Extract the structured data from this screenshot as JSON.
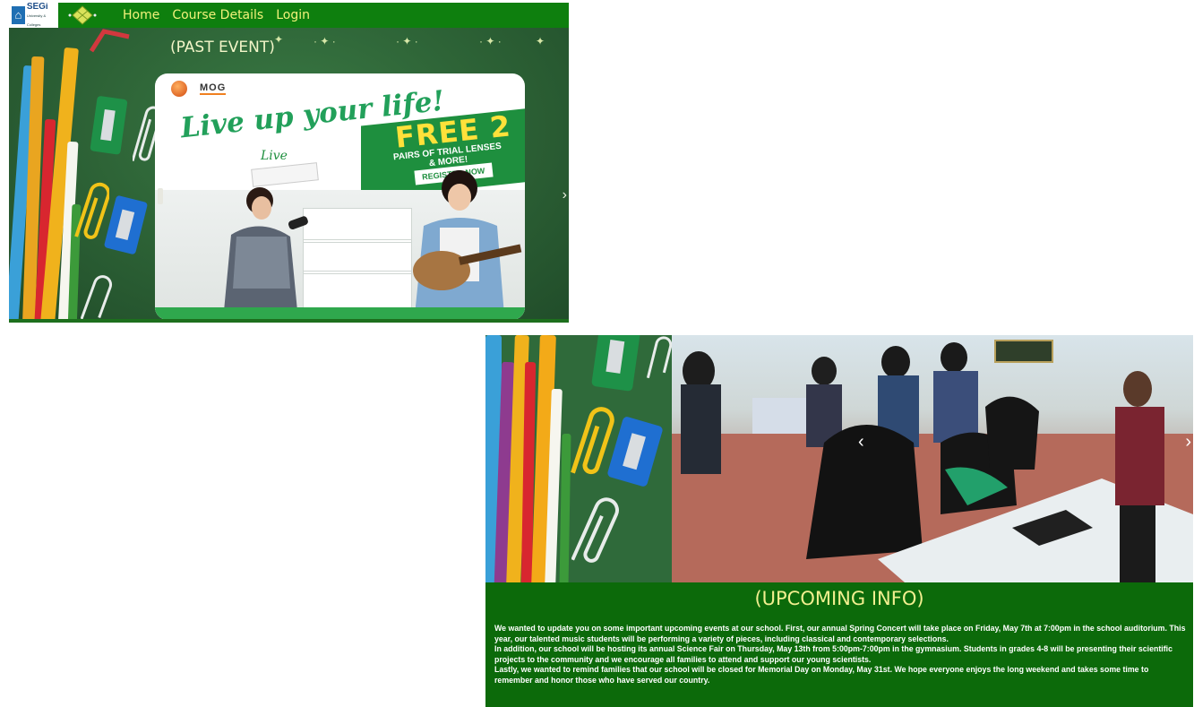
{
  "nav": {
    "logo_text": "SEGi",
    "logo_sub": "University & Colleges",
    "links": [
      "Home",
      "Course Details",
      "Login"
    ]
  },
  "past_event": {
    "title": "(PAST EVENT)",
    "ad": {
      "brand": "MOG",
      "headline": "Live up your life!",
      "free": "FREE 2",
      "trial": "PAIRS OF TRIAL LENSES & MORE!",
      "register": "REGISTER NOW",
      "product": "Live"
    }
  },
  "upcoming": {
    "title": "(UPCOMING INFO)",
    "paragraphs": [
      "We wanted to update you on some important upcoming events at our school. First, our annual Spring Concert will take place on Friday, May 7th at 7:00pm in the school auditorium. This year, our talented music students will be performing a variety of pieces, including classical and contemporary selections.",
      "In addition, our school will be hosting its annual Science Fair on Thursday, May 13th from 5:00pm-7:00pm in the gymnasium. Students in grades 4-8 will be presenting their scientific projects to the community and we encourage all families to attend and support our young scientists.",
      "Lastly, we wanted to remind families that our school will be closed for Memorial Day on Monday, May 31st. We hope everyone enjoys the long weekend and takes some time to remember and honor those who have served our country."
    ]
  },
  "colors": {
    "nav_bg": "#0e7f0e",
    "nav_link": "#f2f27a",
    "chalkboard": "#2c6135",
    "info_bg": "#0c6a0a",
    "info_title": "#f2ef8f"
  },
  "icons": [
    "segi-logo-icon",
    "ketupat-icon",
    "chevron-right-icon",
    "chevron-left-icon"
  ]
}
